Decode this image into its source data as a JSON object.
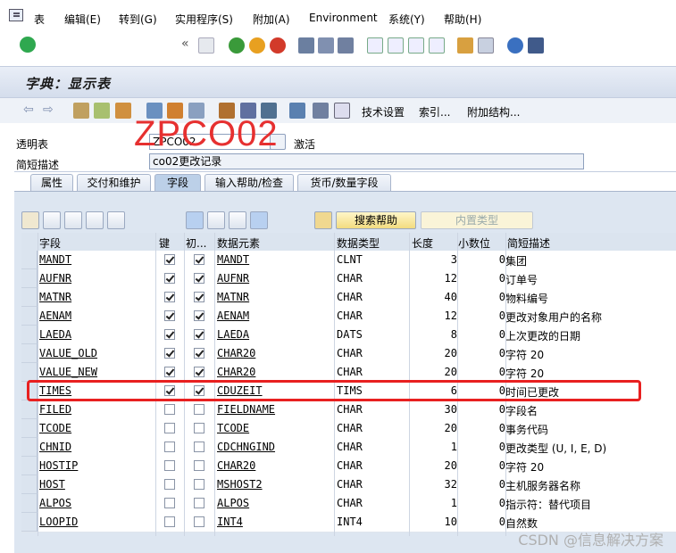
{
  "menu": [
    "表",
    "编辑(E)",
    "转到(G)",
    "实用程序(S)",
    "附加(A)",
    "Environment",
    "系统(Y)",
    "帮助(H)"
  ],
  "title": "字典：显示表",
  "toolbar2": {
    "tech_settings": "技术设置",
    "index": "索引...",
    "append": "附加结构..."
  },
  "form": {
    "table_label": "透明表",
    "table_value": "ZPCO02",
    "status": "激活",
    "desc_label": "简短描述",
    "desc_value": "co02更改记录"
  },
  "overlay_text": "ZPCO02",
  "tabs": [
    "属性",
    "交付和维护",
    "字段",
    "输入帮助/检查",
    "货币/数量字段"
  ],
  "buttons": {
    "search_help": "搜索帮助",
    "builtin_type": "内置类型"
  },
  "columns": [
    "字段",
    "键",
    "初...",
    "数据元素",
    "数据类型",
    "长度",
    "小数位",
    "简短描述"
  ],
  "rows": [
    {
      "field": "MANDT",
      "key": true,
      "init": true,
      "elem": "MANDT",
      "type": "CLNT",
      "len": "3",
      "dec": "0",
      "desc": "集团"
    },
    {
      "field": "AUFNR",
      "key": true,
      "init": true,
      "elem": "AUFNR",
      "type": "CHAR",
      "len": "12",
      "dec": "0",
      "desc": "订单号"
    },
    {
      "field": "MATNR",
      "key": true,
      "init": true,
      "elem": "MATNR",
      "type": "CHAR",
      "len": "40",
      "dec": "0",
      "desc": "物料编号"
    },
    {
      "field": "AENAM",
      "key": true,
      "init": true,
      "elem": "AENAM",
      "type": "CHAR",
      "len": "12",
      "dec": "0",
      "desc": "更改对象用户的名称"
    },
    {
      "field": "LAEDA",
      "key": true,
      "init": true,
      "elem": "LAEDA",
      "type": "DATS",
      "len": "8",
      "dec": "0",
      "desc": "上次更改的日期"
    },
    {
      "field": "VALUE_OLD",
      "key": true,
      "init": true,
      "elem": "CHAR20",
      "type": "CHAR",
      "len": "20",
      "dec": "0",
      "desc": "字符 20"
    },
    {
      "field": "VALUE_NEW",
      "key": true,
      "init": true,
      "elem": "CHAR20",
      "type": "CHAR",
      "len": "20",
      "dec": "0",
      "desc": "字符 20"
    },
    {
      "field": "TIMES",
      "key": true,
      "init": true,
      "elem": "CDUZEIT",
      "type": "TIMS",
      "len": "6",
      "dec": "0",
      "desc": "时间已更改"
    },
    {
      "field": "FILED",
      "key": false,
      "init": false,
      "elem": "FIELDNAME",
      "type": "CHAR",
      "len": "30",
      "dec": "0",
      "desc": "字段名"
    },
    {
      "field": "TCODE",
      "key": false,
      "init": false,
      "elem": "TCODE",
      "type": "CHAR",
      "len": "20",
      "dec": "0",
      "desc": "事务代码"
    },
    {
      "field": "CHNID",
      "key": false,
      "init": false,
      "elem": "CDCHNGIND",
      "type": "CHAR",
      "len": "1",
      "dec": "0",
      "desc": "更改类型 (U, I, E, D)"
    },
    {
      "field": "HOSTIP",
      "key": false,
      "init": false,
      "elem": "CHAR20",
      "type": "CHAR",
      "len": "20",
      "dec": "0",
      "desc": "字符 20"
    },
    {
      "field": "HOST",
      "key": false,
      "init": false,
      "elem": "MSHOST2",
      "type": "CHAR",
      "len": "32",
      "dec": "0",
      "desc": "主机服务器名称"
    },
    {
      "field": "ALPOS",
      "key": false,
      "init": false,
      "elem": "ALPOS",
      "type": "CHAR",
      "len": "1",
      "dec": "0",
      "desc": "指示符：替代项目"
    },
    {
      "field": "LOOPID",
      "key": false,
      "init": false,
      "elem": "INT4",
      "type": "INT4",
      "len": "10",
      "dec": "0",
      "desc": "自然数"
    }
  ],
  "watermark": "CSDN @信息解决方案"
}
